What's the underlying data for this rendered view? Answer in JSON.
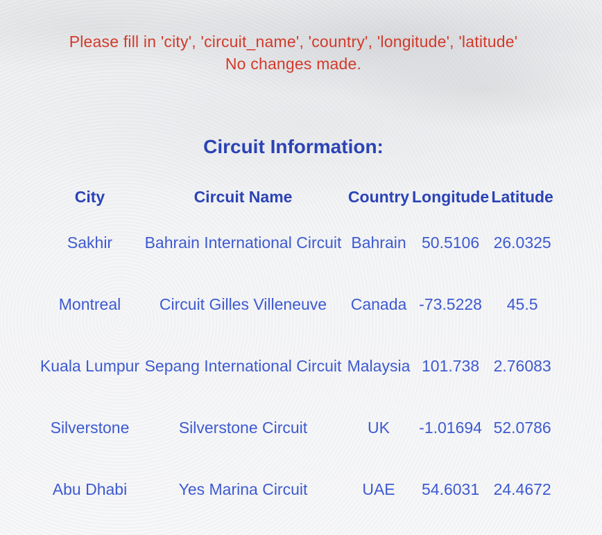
{
  "messages": {
    "error_line": "Please fill in 'city', 'circuit_name', 'country', 'longitude', 'latitude'",
    "status_line": "No changes made."
  },
  "section": {
    "title": "Circuit Information:"
  },
  "table": {
    "headers": {
      "city": "City",
      "circuit_name": "Circuit Name",
      "country": "Country",
      "longitude": "Longitude",
      "latitude": "Latitude"
    },
    "rows": [
      {
        "city": "Sakhir",
        "circuit_name": "Bahrain International Circuit",
        "country": "Bahrain",
        "longitude": "50.5106",
        "latitude": "26.0325"
      },
      {
        "city": "Montreal",
        "circuit_name": "Circuit Gilles Villeneuve",
        "country": "Canada",
        "longitude": "-73.5228",
        "latitude": "45.5"
      },
      {
        "city": "Kuala Lumpur",
        "circuit_name": "Sepang International Circuit",
        "country": "Malaysia",
        "longitude": "101.738",
        "latitude": "2.76083"
      },
      {
        "city": "Silverstone",
        "circuit_name": "Silverstone Circuit",
        "country": "UK",
        "longitude": "-1.01694",
        "latitude": "52.0786"
      },
      {
        "city": "Abu Dhabi",
        "circuit_name": "Yes Marina Circuit",
        "country": "UAE",
        "longitude": "54.6031",
        "latitude": "24.4672"
      }
    ]
  },
  "colors": {
    "error_text": "#d23a2a",
    "heading": "#2b43b5",
    "cell_text": "#3d5ad0"
  }
}
